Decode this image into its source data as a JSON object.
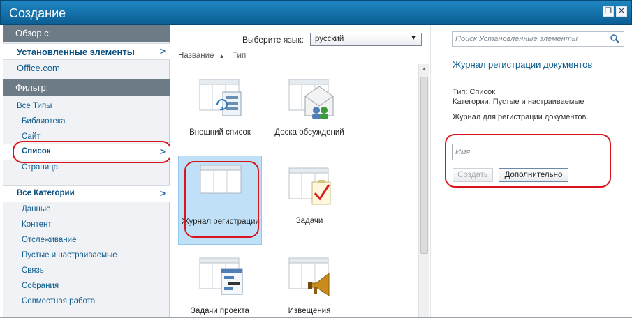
{
  "window": {
    "title": "Создание",
    "restore_glyph": "❐",
    "close_glyph": "✕"
  },
  "leftnav": {
    "browse_header": "Обзор с:",
    "browse_items": [
      {
        "label": "Установленные элементы"
      },
      {
        "label": "Office.com"
      }
    ],
    "filter_header": "Фильтр:",
    "type_items": [
      {
        "label": "Все Типы"
      },
      {
        "label": "Библиотека"
      },
      {
        "label": "Сайт"
      },
      {
        "label": "Список"
      },
      {
        "label": "Страница"
      }
    ],
    "category_items": [
      {
        "label": "Все Категории"
      },
      {
        "label": "Данные"
      },
      {
        "label": "Контент"
      },
      {
        "label": "Отслеживание"
      },
      {
        "label": "Пустые и настраиваемые"
      },
      {
        "label": "Связь"
      },
      {
        "label": "Собрания"
      },
      {
        "label": "Совместная работа"
      }
    ],
    "chevron_glyph": ">"
  },
  "middle": {
    "language_label": "Выберите язык:",
    "language_value": "русский",
    "sort_name": "Название",
    "sort_arrow": "▲",
    "sort_type": "Тип",
    "tiles": [
      {
        "label": "Внешний список",
        "icon": "external-list-icon"
      },
      {
        "label": "Доска обсуждений",
        "icon": "discussion-board-icon"
      },
      {
        "label": "Журнал регистрации",
        "icon": "register-log-icon"
      },
      {
        "label": "Задачи",
        "icon": "tasks-icon"
      },
      {
        "label": "Задачи проекта",
        "icon": "project-tasks-icon"
      },
      {
        "label": "Извещения",
        "icon": "announcements-icon"
      }
    ]
  },
  "right": {
    "search_placeholder": "Поиск Установленные элементы",
    "item_title": "Журнал регистрации документов",
    "type_line": "Тип: Список",
    "categories_line": "Категории: Пустые и настраиваемые",
    "description": "Журнал для регистрации документов.",
    "name_placeholder": "Имя",
    "create_button": "Создать",
    "more_button": "Дополнительно"
  },
  "colors": {
    "titlebar": "#0b5e93",
    "accent": "#0d5c8f",
    "nav_header": "#6d7b86",
    "selected_tile": "#bfe0f7",
    "highlight_outline": "#d9141c"
  }
}
